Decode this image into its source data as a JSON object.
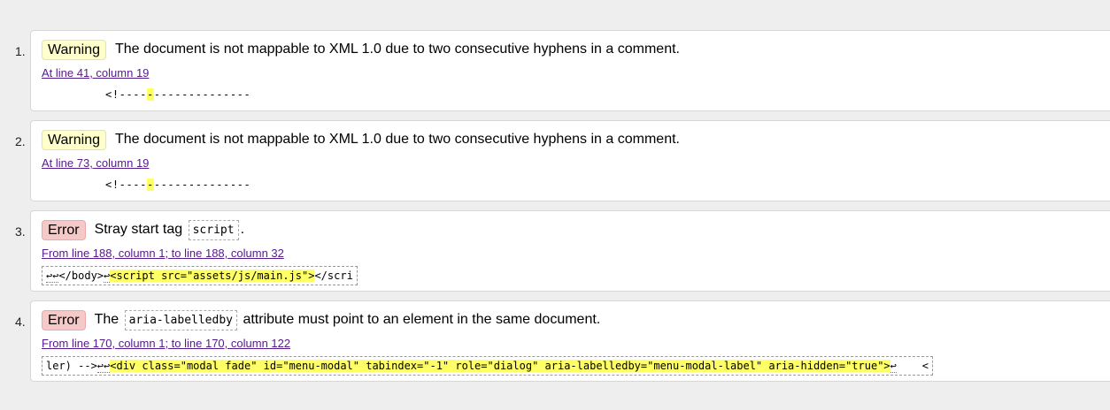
{
  "messages": [
    {
      "number": "1.",
      "type_label": "Warning",
      "text": "The document is not mappable to XML 1.0 due to two consecutive hyphens in a comment.",
      "location": "At line 41, column 19",
      "extract_pre": "<!----",
      "extract_hl": "-",
      "extract_post": "--------------"
    },
    {
      "number": "2.",
      "type_label": "Warning",
      "text": "The document is not mappable to XML 1.0 due to two consecutive hyphens in a comment.",
      "location": "At line 73, column 19",
      "extract_pre": "<!----",
      "extract_hl": "-",
      "extract_post": "--------------"
    },
    {
      "number": "3.",
      "type_label": "Error",
      "text_before": "Stray start tag",
      "code": "script",
      "text_after": ".",
      "location": "From line 188, column 1; to line 188, column 32",
      "extract_lf": "↩↩",
      "extract_pre": "</body>",
      "extract_lf2": "↩",
      "extract_hl": "<script src=\"assets/js/main.js\">",
      "extract_post": "</scri"
    },
    {
      "number": "4.",
      "type_label": "Error",
      "text_before": "The",
      "code": "aria-labelledby",
      "text_after": "attribute must point to an element in the same document.",
      "location": "From line 170, column 1; to line 170, column 122",
      "extract_pre": "ler) -->",
      "extract_lf": "↩↩",
      "extract_hl": "<div class=\"modal fade\" id=\"menu-modal\" tabindex=\"-1\" role=\"dialog\" aria-labelledby=\"menu-modal-label\" aria-hidden=\"true\">",
      "extract_lf2": "↩",
      "extract_post": "    <"
    }
  ]
}
